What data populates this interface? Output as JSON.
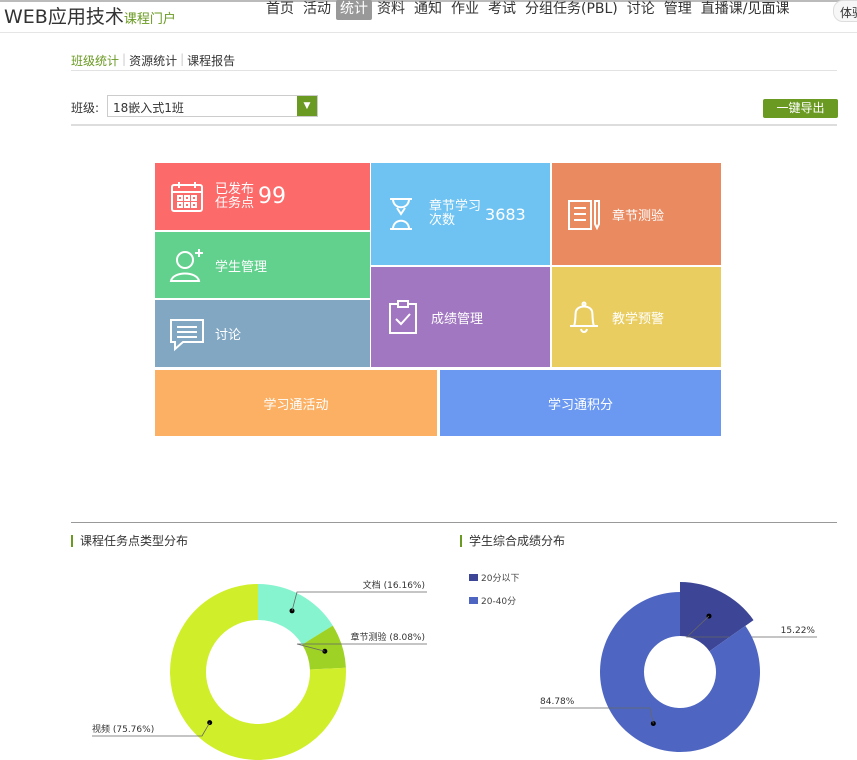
{
  "header": {
    "title": "WEB应用技术",
    "subtitle": "课程门户",
    "nav": [
      "首页",
      "活动",
      "统计",
      "资料",
      "通知",
      "作业",
      "考试",
      "分组任务(PBL)",
      "讨论",
      "管理",
      "直播课/见面课"
    ],
    "active": "统计",
    "search": "体验"
  },
  "subnav": {
    "items": [
      "班级统计",
      "资源统计",
      "课程报告"
    ]
  },
  "filter": {
    "label": "班级:",
    "value": "18嵌入式1班",
    "export": "一键导出"
  },
  "tiles": {
    "published": {
      "l1": "已发布",
      "l2": "任务点",
      "num": "99",
      "color": "#FD6A6A"
    },
    "chapter": {
      "l1": "章节学习",
      "l2": "次数",
      "num": "3683",
      "color": "#6FC3F2"
    },
    "quiz": {
      "label": "章节测验",
      "color": "#EA8A60"
    },
    "students": {
      "label": "学生管理",
      "color": "#62D18E"
    },
    "discuss": {
      "label": "讨论",
      "color": "#81A7C3"
    },
    "grades": {
      "label": "成绩管理",
      "color": "#A277C1"
    },
    "warning": {
      "label": "教学预警",
      "color": "#E9CD61"
    },
    "activity": {
      "label": "学习通活动",
      "color": "#FCB063"
    },
    "points": {
      "label": "学习通积分",
      "color": "#6B99F2"
    }
  },
  "chart_data": [
    {
      "type": "pie",
      "donut": true,
      "title": "课程任务点类型分布",
      "labels": [
        "文档",
        "章节测验",
        "视频"
      ],
      "values": [
        16.16,
        8.08,
        75.76
      ],
      "label_texts": [
        "文档 (16.16%)",
        "章节测验 (8.08%)",
        "视频 (75.76%)"
      ],
      "colors": [
        "#86F4CE",
        "#9ED225",
        "#D1EE2A"
      ]
    },
    {
      "type": "pie",
      "donut": true,
      "title": "学生综合成绩分布",
      "labels": [
        "20分以下",
        "20-40分"
      ],
      "values": [
        15.22,
        84.78
      ],
      "label_texts": [
        "15.22%",
        "84.78%"
      ],
      "colors": [
        "#3C4596",
        "#4E66C2"
      ],
      "legend": "top-left"
    }
  ]
}
